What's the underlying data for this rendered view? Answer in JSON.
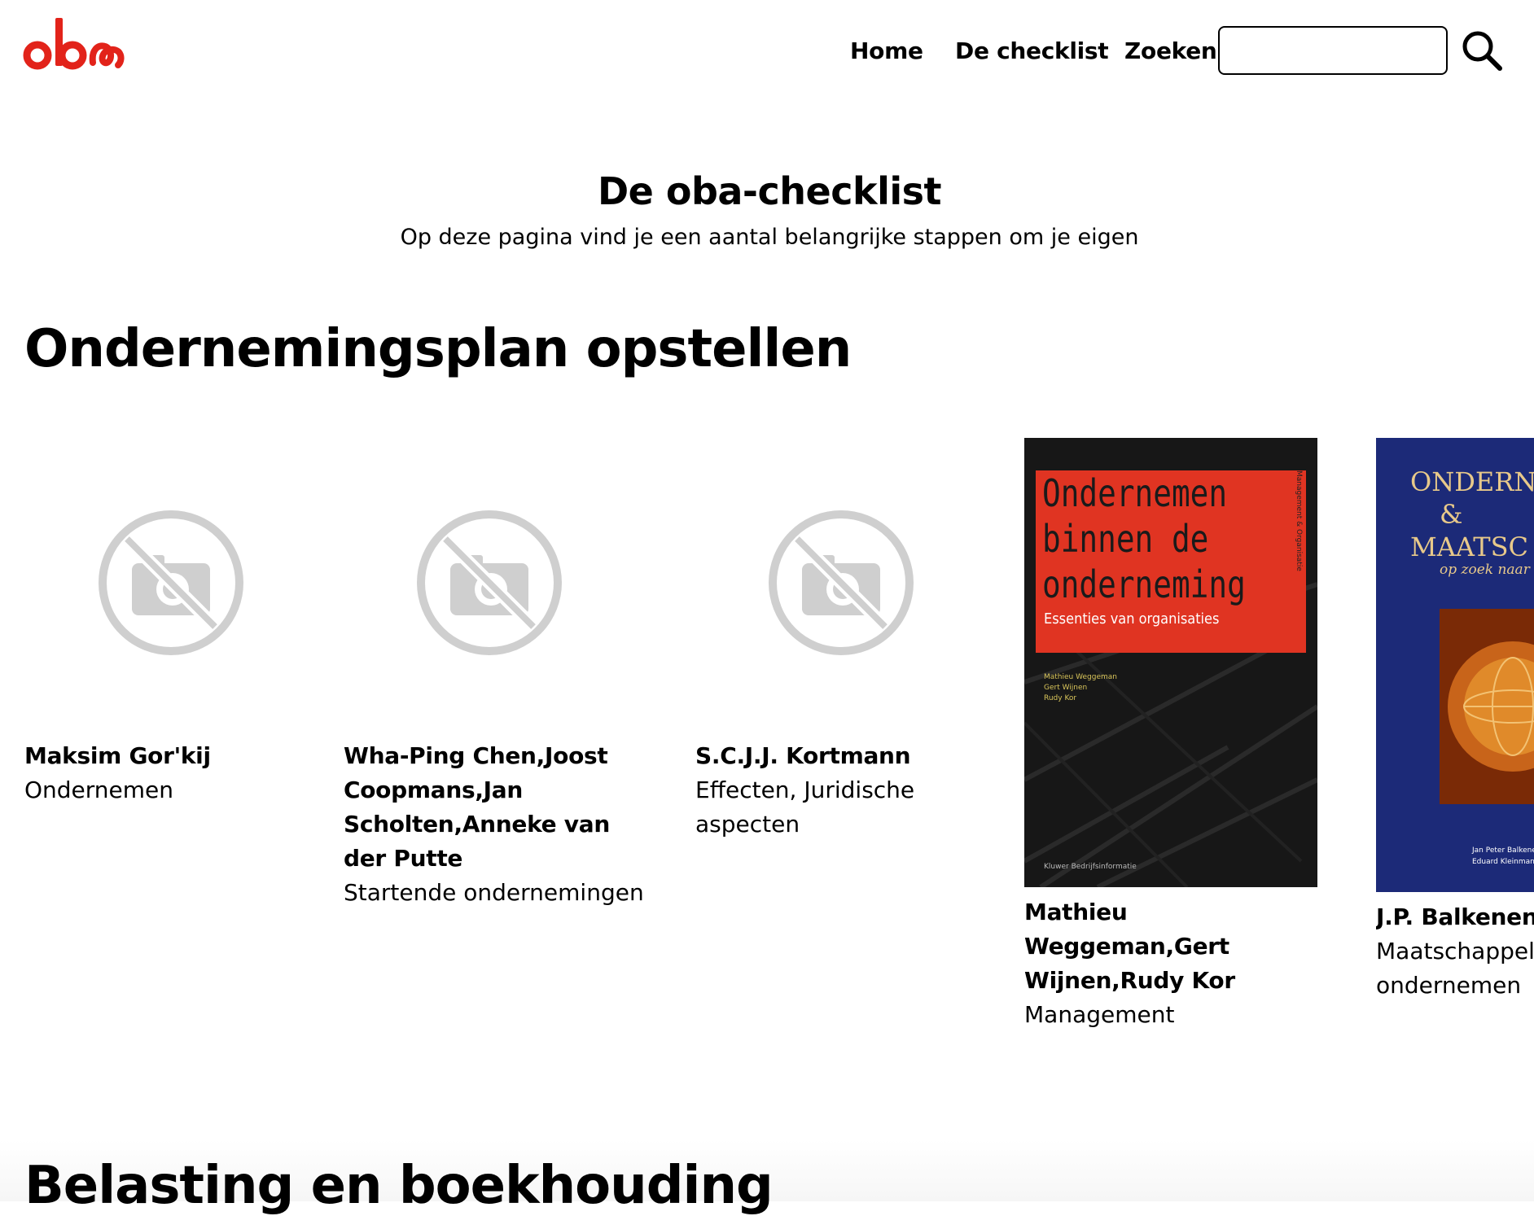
{
  "header": {
    "logo_text": "oba",
    "brand_color": "#e2231a",
    "nav": [
      "Home",
      "De checklist",
      "Zoeken"
    ],
    "search": {
      "value": "",
      "icon": "search-icon"
    }
  },
  "page": {
    "title": "De oba-checklist",
    "intro": "Op deze pagina vind je een aantal belangrijke stappen om je eigen"
  },
  "sections": [
    {
      "heading": "Ondernemingsplan opstellen",
      "items": [
        {
          "author": "Maksim Gor'kij",
          "subject": "Ondernemen",
          "image": "no-image-icon"
        },
        {
          "author": "Wha-Ping Chen,Joost Coopmans,Jan Scholten,Anneke van der Putte",
          "subject": "Startende ondernemingen",
          "image": "no-image-icon"
        },
        {
          "author": "S.C.J.J. Kortmann",
          "subject": "Effecten, Juridische aspecten",
          "image": "no-image-icon"
        },
        {
          "author": "Mathieu Weggeman,Gert Wijnen,Rudy Kor",
          "subject": "Management",
          "image": "book-cover",
          "cover": {
            "title_lines": [
              "Ondernemen",
              "binnen de",
              "onderneming"
            ],
            "subtitle": "Essenties van organisaties",
            "authors": [
              "Mathieu Weggeman",
              "Gert Wijnen",
              "Rudy Kor"
            ],
            "spine": "Management & Organisatie",
            "publisher": "Kluwer Bedrijfsinformatie"
          }
        },
        {
          "author": "J.P. Balkenende",
          "subject": "Maatschappelij ondernemen",
          "image": "book-cover",
          "cover": {
            "title_lines": [
              "ONDERN",
              "&",
              "MAATSC"
            ],
            "subtitle": "op zoek naar",
            "authors": [
              "Jan Peter Balkenende",
              "Eduard Kleinman"
            ]
          }
        }
      ]
    },
    {
      "heading": "Belasting en boekhouding"
    }
  ]
}
